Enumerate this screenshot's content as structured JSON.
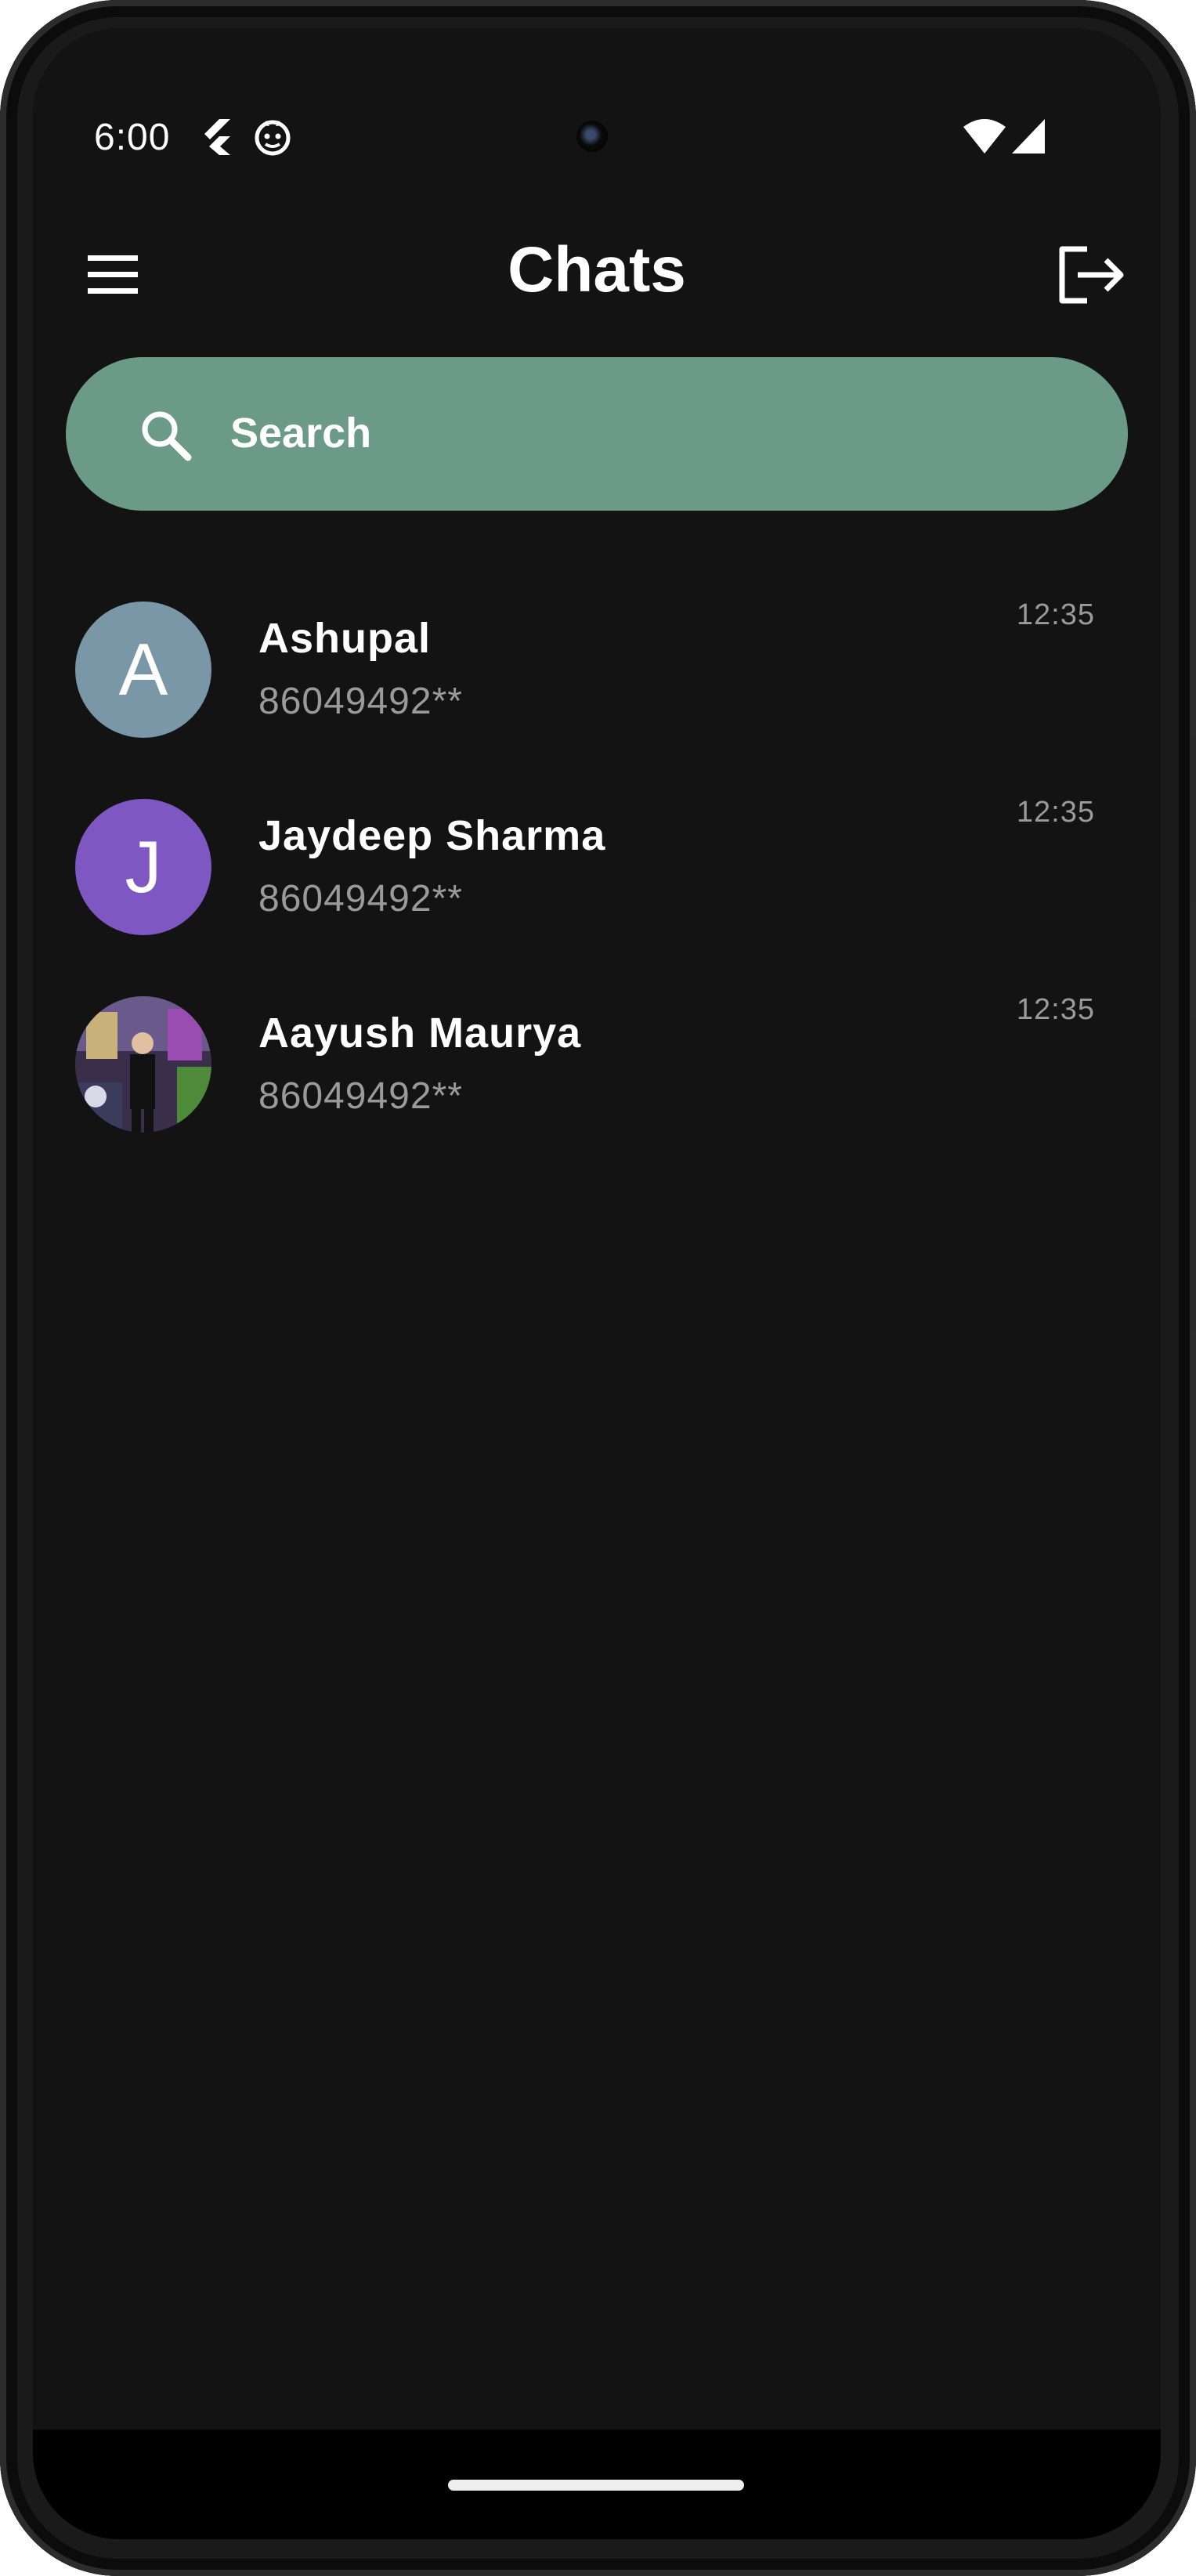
{
  "status_bar": {
    "time": "6:00",
    "icons": [
      "flutter-icon",
      "debug-icon",
      "wifi-icon",
      "signal-icon"
    ]
  },
  "app_bar": {
    "title": "Chats",
    "menu_icon": "menu-icon",
    "logout_icon": "logout-icon"
  },
  "search": {
    "placeholder": "Search",
    "icon": "search-icon",
    "background": "#6b9a88"
  },
  "chats": [
    {
      "name": "Ashupal",
      "subtitle": "86049492**",
      "time": "12:35",
      "avatar_letter": "A",
      "avatar_color": "#7a97a8"
    },
    {
      "name": "Jaydeep Sharma",
      "subtitle": "86049492**",
      "time": "12:35",
      "avatar_letter": "J",
      "avatar_color": "#7e57c2"
    },
    {
      "name": "Aayush Maurya",
      "subtitle": "86049492**",
      "time": "12:35",
      "avatar_letter": "",
      "avatar_photo": true
    }
  ],
  "colors": {
    "background": "#131313",
    "text_primary": "#ffffff",
    "text_secondary": "#9a9a9a"
  }
}
